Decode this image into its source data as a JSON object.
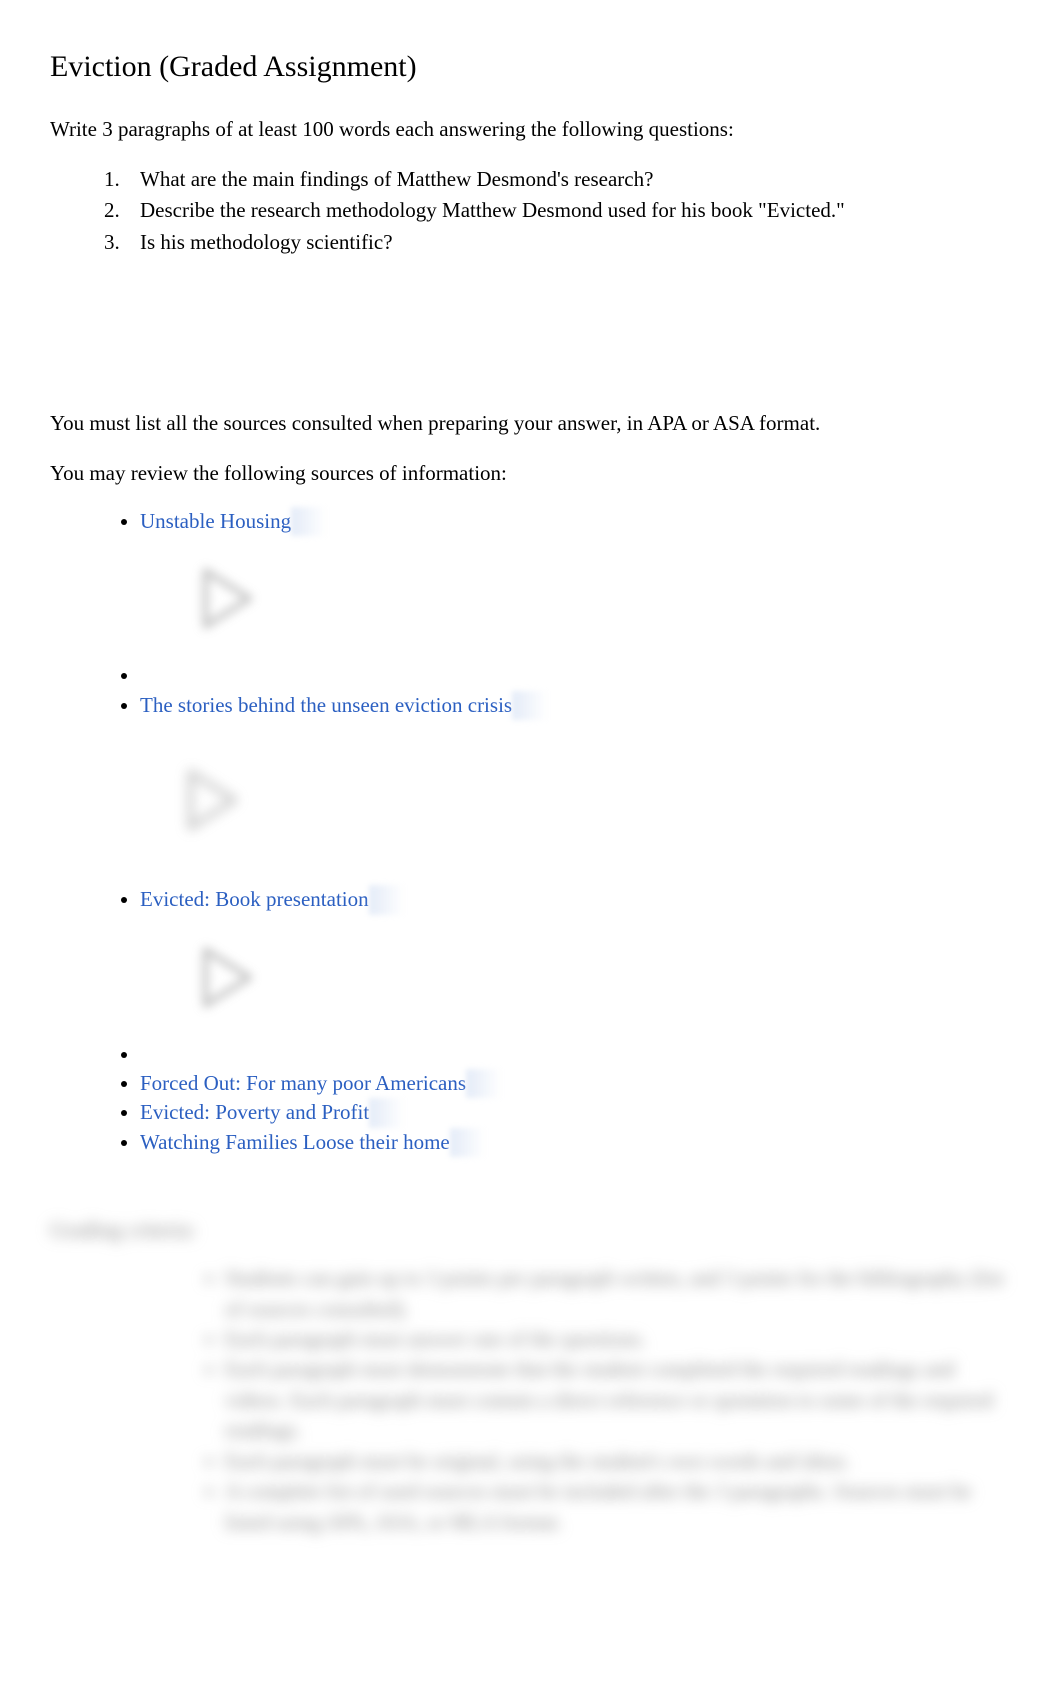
{
  "title": "Eviction (Graded Assignment)",
  "intro": "Write 3 paragraphs of at least 100 words each answering the following questions:",
  "questions": [
    "What are the main findings of Matthew Desmond's research?",
    "Describe the research methodology Matthew Desmond used for his book \"Evicted.\"",
    "Is his methodology scientific?"
  ],
  "sourcesNote": "You must list all the sources consulted when preparing your answer, in APA or ASA format.",
  "reviewNote": "You may review the following sources of information:",
  "sources": {
    "link1": "Unstable Housing",
    "link2": "The stories behind the unseen eviction crisis",
    "link3": "Evicted: Book presentation",
    "link4": "Forced Out: For many poor Americans",
    "link5": "Evicted: Poverty and Profit",
    "link6": "Watching Families Loose their home"
  },
  "grading": {
    "title": "Grading criteria:",
    "items": [
      "Students can gain up to 3 points per paragraph written, and 3 points for the bibliography (list of sources consulted).",
      "Each paragraph must answer one of the questions.",
      "Each paragraph must demonstrate that the student completed the required readings and videos. Each paragraph must contain a direct reference or quotation to some of the required readings.",
      "Each paragraph must be original, using the student's own words and ideas.",
      "A complete list of used sources must be included after the 3 paragraphs. Sources must be listed using APA, ASA, or MLA format."
    ]
  }
}
